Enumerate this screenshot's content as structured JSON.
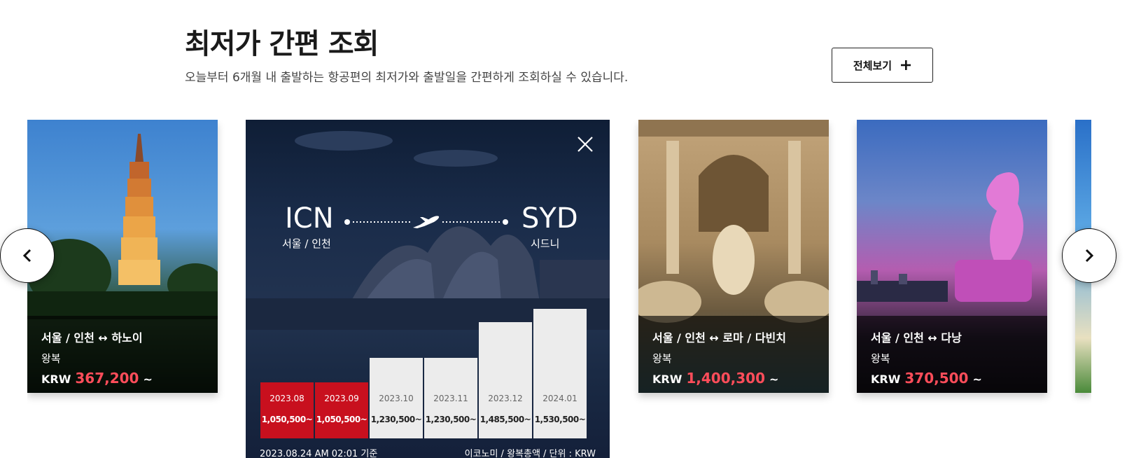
{
  "header": {
    "title": "최저가 간편 조회",
    "subtitle": "오늘부터 6개월 내 출발하는 항공편의 최저가와 출발일을 간편하게 조회하실 수 있습니다.",
    "view_all_label": "전체보기",
    "view_all_icon": "plus-icon"
  },
  "cards": [
    {
      "route": "서울 / 인천 ↔ 하노이",
      "trip": "왕복",
      "currency": "KRW",
      "price": "367,200",
      "suffix": "~"
    },
    {
      "route": "서울 / 인천 ↔ 로마 / 다빈치",
      "trip": "왕복",
      "currency": "KRW",
      "price": "1,400,300",
      "suffix": "~"
    },
    {
      "route": "서울 / 인천 ↔ 다낭",
      "trip": "왕복",
      "currency": "KRW",
      "price": "370,500",
      "suffix": "~"
    }
  ],
  "expanded": {
    "origin_code": "ICN",
    "origin_city": "서울 / 인천",
    "dest_code": "SYD",
    "dest_city": "시드니",
    "close_icon": "close-icon",
    "months": [
      {
        "month": "2023.08",
        "price": "1,050,500~",
        "highlight": true
      },
      {
        "month": "2023.09",
        "price": "1,050,500~",
        "highlight": true
      },
      {
        "month": "2023.10",
        "price": "1,230,500~",
        "highlight": false
      },
      {
        "month": "2023.11",
        "price": "1,230,500~",
        "highlight": false
      },
      {
        "month": "2023.12",
        "price": "1,485,500~",
        "highlight": false
      },
      {
        "month": "2024.01",
        "price": "1,530,500~",
        "highlight": false
      }
    ],
    "footer_left": "2023.08.24 AM 02:01 기준",
    "footer_right": "이코노미 / 왕복총액 / 단위 : KRW"
  },
  "nav": {
    "prev_icon": "chevron-left-icon",
    "next_icon": "chevron-right-icon"
  },
  "colors": {
    "accent_red": "#c8101e",
    "price_red": "#ff4d5a",
    "bar_gray": "#ececec"
  }
}
